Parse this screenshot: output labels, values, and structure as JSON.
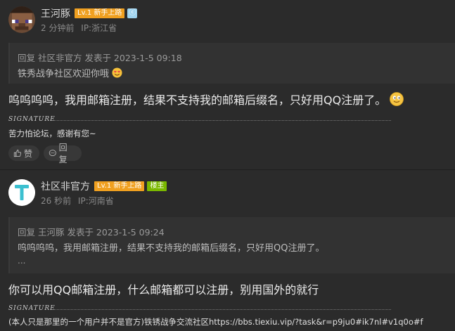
{
  "posts": [
    {
      "author": "王河豚",
      "level_badge": "Lv.1 新手上路",
      "verify_badge": "ⓒ",
      "time": "2 分钟前",
      "ip": "IP:浙江省",
      "quote": {
        "header": "回复 社区非官方 发表于 2023-1-5 09:18",
        "text": "铁秀战争社区欢迎你哦"
      },
      "body": "呜呜呜呜，我用邮箱注册，结果不支持我的邮箱后缀名，只好用QQ注册了。",
      "signature_label": "SIGNATURE",
      "signature": "苦力怕论坛，感谢有您~",
      "like_label": "赞",
      "reply_label": "回复"
    },
    {
      "author": "社区非官方",
      "level_badge": "Lv.1 新手上路",
      "op_badge": "楼主",
      "avatar_letter": "T",
      "time": "26 秒前",
      "ip": "IP:河南省",
      "quote": {
        "header": "回复 王河豚 发表于 2023-1-5 09:24",
        "text": "呜呜呜呜，我用邮箱注册，结果不支持我的邮箱后缀名，只好用QQ注册了。",
        "more": "..."
      },
      "body": "你可以用QQ邮箱注册，什么邮箱都可以注册，别用国外的就行",
      "signature_label": "SIGNATURE",
      "signature": "(本人只是那里的一个用户并不是官方)铁锈战争交流社区https://bbs.tiexiu.vip/?task&r=p9ju0#ik7nl#v1q0o#f"
    }
  ],
  "colors": {
    "background": "#2b2b2b",
    "level_badge": "#f0a020",
    "op_badge": "#7ab800",
    "avatar_t": "#3cc0d0"
  }
}
